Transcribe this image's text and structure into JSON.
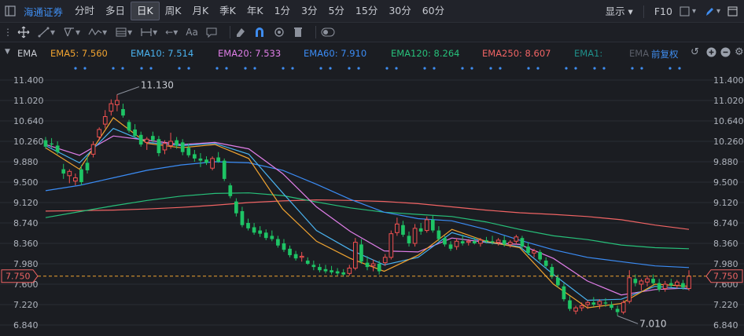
{
  "topbar": {
    "stock_name": "海通证券",
    "periods": [
      "分时",
      "多日",
      "日K",
      "周K",
      "月K",
      "季K",
      "年K",
      "1分",
      "3分",
      "5分",
      "15分",
      "30分",
      "60分"
    ],
    "active_period": "日K",
    "display_label": "显示",
    "f10_label": "F10"
  },
  "toolbar": {
    "text_tool": "Aa"
  },
  "indicator": {
    "name": "EMA",
    "items": [
      {
        "label": "EMA5: 7.560",
        "color": "#f0a330"
      },
      {
        "label": "EMA10: 7.514",
        "color": "#4ab3f0"
      },
      {
        "label": "EMA20: 7.533",
        "color": "#e07ee8"
      },
      {
        "label": "EMA60: 7.910",
        "color": "#3b8cf5"
      },
      {
        "label": "EMA120: 8.264",
        "color": "#27c07a"
      },
      {
        "label": "EMA250: 8.607",
        "color": "#f06464"
      },
      {
        "label": "EMA1:",
        "color": "#1f8f8a"
      },
      {
        "label": "EMA",
        "color": "#5a5e68"
      }
    ],
    "adjust_label": "前复权"
  },
  "chart_data": {
    "type": "candlestick",
    "y_ticks": [
      "11.400",
      "11.020",
      "10.640",
      "10.260",
      "9.880",
      "9.500",
      "9.120",
      "8.740",
      "8.360",
      "7.980",
      "7.600",
      "7.220",
      "6.840"
    ],
    "ylim": [
      6.84,
      11.4
    ],
    "current_price": "7.750",
    "annotations": [
      {
        "text": "11.130",
        "value": 11.13
      },
      {
        "text": "7.010",
        "value": 7.01
      }
    ],
    "candles_ohlc": [
      [
        10.28,
        10.34,
        10.12,
        10.16
      ],
      [
        10.22,
        10.32,
        10.14,
        10.2
      ],
      [
        10.18,
        10.26,
        10.02,
        10.06
      ],
      [
        9.74,
        9.84,
        9.56,
        9.66
      ],
      [
        9.62,
        9.74,
        9.48,
        9.7
      ],
      [
        9.52,
        9.66,
        9.44,
        9.58
      ],
      [
        9.74,
        9.82,
        9.44,
        9.5
      ],
      [
        9.86,
        9.98,
        9.66,
        9.72
      ],
      [
        10.02,
        10.26,
        9.96,
        10.2
      ],
      [
        10.34,
        10.52,
        10.28,
        10.48
      ],
      [
        10.58,
        10.84,
        10.5,
        10.72
      ],
      [
        10.82,
        11.04,
        10.74,
        10.96
      ],
      [
        10.94,
        11.13,
        10.82,
        11.02
      ],
      [
        10.86,
        10.96,
        10.7,
        10.74
      ],
      [
        10.62,
        10.66,
        10.42,
        10.46
      ],
      [
        10.48,
        10.58,
        10.32,
        10.36
      ],
      [
        10.38,
        10.44,
        10.16,
        10.2
      ],
      [
        10.24,
        10.34,
        10.1,
        10.3
      ],
      [
        10.36,
        10.44,
        10.24,
        10.28
      ],
      [
        10.3,
        10.36,
        9.98,
        10.04
      ],
      [
        10.1,
        10.28,
        10.02,
        10.22
      ],
      [
        10.18,
        10.42,
        10.12,
        10.26
      ],
      [
        10.28,
        10.34,
        10.12,
        10.18
      ],
      [
        10.24,
        10.3,
        10.0,
        10.06
      ],
      [
        10.14,
        10.22,
        9.96,
        10.0
      ],
      [
        10.02,
        10.1,
        9.88,
        9.94
      ],
      [
        9.94,
        10.04,
        9.78,
        9.9
      ],
      [
        9.92,
        9.98,
        9.82,
        9.86
      ],
      [
        9.76,
        9.98,
        9.72,
        9.94
      ],
      [
        9.96,
        10.06,
        9.86,
        9.88
      ],
      [
        9.9,
        9.94,
        9.52,
        9.56
      ],
      [
        9.44,
        9.48,
        9.2,
        9.24
      ],
      [
        9.14,
        9.2,
        8.86,
        8.92
      ],
      [
        8.96,
        9.04,
        8.66,
        8.7
      ],
      [
        8.74,
        8.82,
        8.6,
        8.64
      ],
      [
        8.66,
        8.74,
        8.52,
        8.56
      ],
      [
        8.6,
        8.68,
        8.48,
        8.54
      ],
      [
        8.56,
        8.62,
        8.42,
        8.46
      ],
      [
        8.5,
        8.6,
        8.4,
        8.44
      ],
      [
        8.44,
        8.5,
        8.28,
        8.32
      ],
      [
        8.36,
        8.44,
        8.2,
        8.24
      ],
      [
        8.26,
        8.32,
        8.1,
        8.14
      ],
      [
        8.16,
        8.22,
        8.04,
        8.08
      ],
      [
        8.1,
        8.2,
        8.02,
        8.12
      ],
      [
        8.04,
        8.1,
        7.96,
        7.98
      ],
      [
        7.96,
        8.04,
        7.86,
        7.92
      ],
      [
        7.92,
        7.98,
        7.82,
        7.86
      ],
      [
        7.88,
        7.96,
        7.8,
        7.84
      ],
      [
        7.86,
        7.94,
        7.78,
        7.82
      ],
      [
        7.84,
        7.9,
        7.76,
        7.8
      ],
      [
        7.82,
        7.88,
        7.74,
        7.78
      ],
      [
        7.8,
        7.96,
        7.76,
        7.9
      ],
      [
        7.9,
        8.46,
        7.86,
        8.38
      ],
      [
        8.34,
        8.44,
        7.98,
        8.02
      ],
      [
        8.0,
        8.12,
        7.86,
        7.92
      ],
      [
        7.94,
        8.06,
        7.84,
        7.98
      ],
      [
        7.98,
        8.04,
        7.78,
        7.84
      ],
      [
        8.0,
        8.16,
        7.94,
        8.1
      ],
      [
        8.1,
        8.6,
        8.06,
        8.54
      ],
      [
        8.56,
        8.84,
        8.5,
        8.72
      ],
      [
        8.7,
        8.78,
        8.48,
        8.52
      ],
      [
        8.5,
        8.58,
        8.3,
        8.36
      ],
      [
        8.36,
        8.72,
        8.3,
        8.64
      ],
      [
        8.64,
        8.74,
        8.52,
        8.58
      ],
      [
        8.6,
        8.86,
        8.56,
        8.8
      ],
      [
        8.8,
        8.88,
        8.56,
        8.6
      ],
      [
        8.6,
        8.68,
        8.4,
        8.44
      ],
      [
        8.46,
        8.5,
        8.3,
        8.34
      ],
      [
        8.34,
        8.4,
        8.22,
        8.26
      ],
      [
        8.3,
        8.46,
        8.24,
        8.4
      ],
      [
        8.4,
        8.52,
        8.32,
        8.36
      ],
      [
        8.38,
        8.44,
        8.32,
        8.4
      ],
      [
        8.4,
        8.48,
        8.34,
        8.36
      ],
      [
        8.36,
        8.46,
        8.3,
        8.42
      ],
      [
        8.42,
        8.48,
        8.36,
        8.4
      ],
      [
        8.4,
        8.5,
        8.34,
        8.38
      ],
      [
        8.38,
        8.46,
        8.32,
        8.42
      ],
      [
        8.42,
        8.5,
        8.3,
        8.34
      ],
      [
        8.34,
        8.42,
        8.28,
        8.38
      ],
      [
        8.4,
        8.52,
        8.34,
        8.48
      ],
      [
        8.46,
        8.5,
        8.26,
        8.3
      ],
      [
        8.3,
        8.38,
        8.14,
        8.18
      ],
      [
        8.18,
        8.26,
        8.1,
        8.22
      ],
      [
        8.2,
        8.24,
        8.02,
        8.06
      ],
      [
        8.04,
        8.1,
        7.9,
        7.94
      ],
      [
        7.92,
        7.98,
        7.7,
        7.74
      ],
      [
        7.72,
        7.78,
        7.54,
        7.58
      ],
      [
        7.56,
        7.62,
        7.28,
        7.32
      ],
      [
        7.3,
        7.38,
        7.1,
        7.14
      ],
      [
        7.1,
        7.2,
        7.04,
        7.16
      ],
      [
        7.16,
        7.26,
        7.1,
        7.2
      ],
      [
        7.22,
        7.3,
        7.14,
        7.26
      ],
      [
        7.26,
        7.36,
        7.18,
        7.22
      ],
      [
        7.22,
        7.32,
        7.14,
        7.28
      ],
      [
        7.26,
        7.34,
        7.18,
        7.24
      ],
      [
        7.22,
        7.28,
        7.12,
        7.16
      ],
      [
        7.14,
        7.2,
        7.01,
        7.08
      ],
      [
        7.08,
        7.3,
        7.04,
        7.26
      ],
      [
        7.28,
        7.86,
        7.24,
        7.72
      ],
      [
        7.7,
        7.78,
        7.56,
        7.62
      ],
      [
        7.6,
        7.7,
        7.48,
        7.66
      ],
      [
        7.64,
        7.76,
        7.56,
        7.7
      ],
      [
        7.7,
        7.78,
        7.58,
        7.62
      ],
      [
        7.62,
        7.7,
        7.46,
        7.5
      ],
      [
        7.52,
        7.66,
        7.46,
        7.6
      ],
      [
        7.62,
        7.7,
        7.54,
        7.58
      ],
      [
        7.58,
        7.68,
        7.52,
        7.64
      ],
      [
        7.62,
        7.68,
        7.5,
        7.54
      ],
      [
        7.52,
        7.86,
        7.48,
        7.75
      ]
    ],
    "series": [
      {
        "name": "EMA250",
        "color": "#f06464",
        "values": [
          8.96,
          8.97,
          8.98,
          9.0,
          9.03,
          9.07,
          9.12,
          9.15,
          9.17,
          9.16,
          9.14,
          9.1,
          9.04,
          8.98,
          8.93,
          8.9,
          8.86,
          8.8,
          8.7,
          8.62
        ]
      },
      {
        "name": "EMA120",
        "color": "#27c07a",
        "values": [
          8.84,
          8.95,
          9.06,
          9.16,
          9.24,
          9.29,
          9.3,
          9.25,
          9.13,
          9.02,
          8.94,
          8.9,
          8.86,
          8.76,
          8.62,
          8.5,
          8.43,
          8.33,
          8.28,
          8.26
        ]
      },
      {
        "name": "EMA60",
        "color": "#3b8cf5",
        "values": [
          9.34,
          9.44,
          9.58,
          9.72,
          9.82,
          9.88,
          9.86,
          9.72,
          9.46,
          9.18,
          8.94,
          8.82,
          8.78,
          8.62,
          8.42,
          8.24,
          8.1,
          8.02,
          7.94,
          7.91
        ]
      },
      {
        "name": "EMA20",
        "color": "#e07ee8",
        "values": [
          10.2,
          10.0,
          10.36,
          10.28,
          10.2,
          10.24,
          10.12,
          9.66,
          9.04,
          8.58,
          8.22,
          8.2,
          8.46,
          8.38,
          8.34,
          8.08,
          7.66,
          7.4,
          7.5,
          7.53
        ]
      },
      {
        "name": "EMA10",
        "color": "#4ab3f0",
        "values": [
          10.18,
          9.86,
          10.5,
          10.24,
          10.18,
          10.22,
          10.02,
          9.3,
          8.6,
          8.24,
          7.96,
          8.1,
          8.56,
          8.38,
          8.3,
          7.78,
          7.3,
          7.32,
          7.56,
          7.51
        ]
      },
      {
        "name": "EMA5",
        "color": "#f0a330",
        "values": [
          10.14,
          9.74,
          10.7,
          10.22,
          10.14,
          10.2,
          9.94,
          9.0,
          8.4,
          8.08,
          7.84,
          8.14,
          8.62,
          8.4,
          8.28,
          7.6,
          7.16,
          7.24,
          7.6,
          7.56
        ]
      }
    ]
  }
}
